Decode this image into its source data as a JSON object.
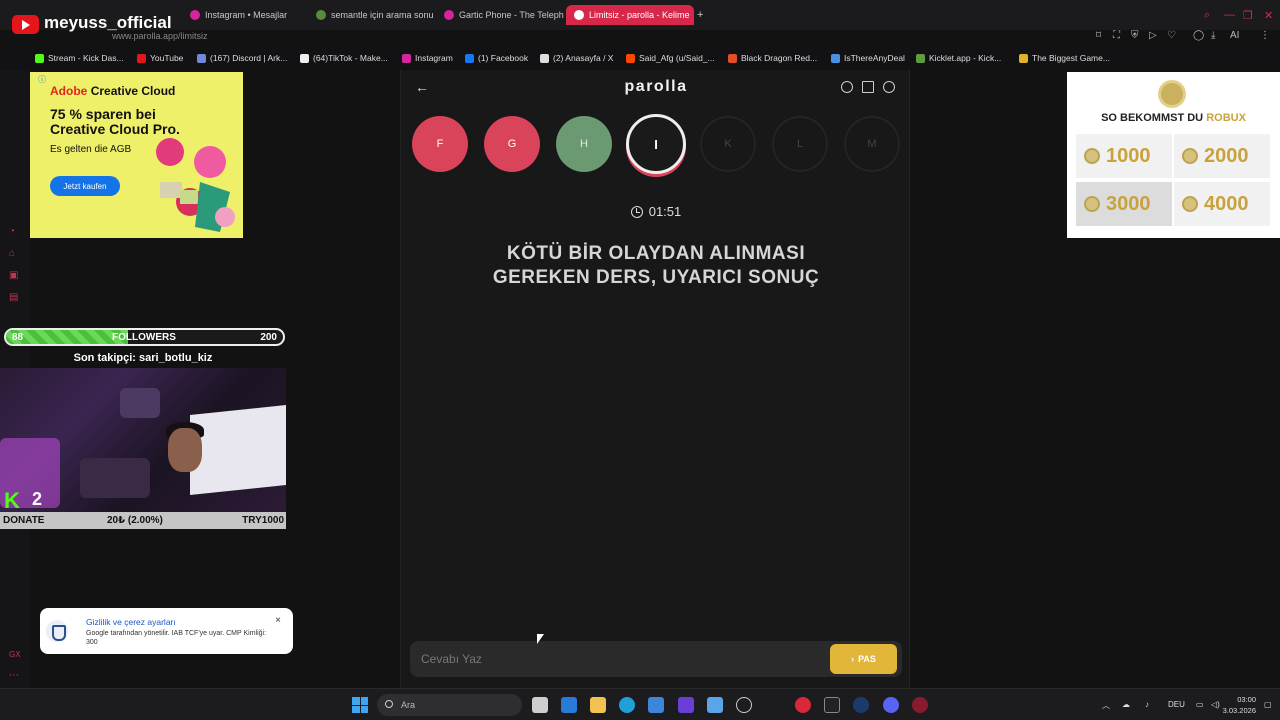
{
  "stream": {
    "channel_name": "meyuss_official",
    "followers_label": "FOLLOWERS",
    "followers_current": "88",
    "followers_goal": "200",
    "followers_progress": 0.44,
    "last_follower": "Son takipçi: sari_botlu_kiz",
    "kick_count": "2",
    "donate_label": "DONATE",
    "donate_amount": "20₺ (2.00%)",
    "donate_goal": "TRY1000"
  },
  "browser": {
    "url": "www.parolla.app/limitsiz",
    "tabs": [
      {
        "label": "Instagram • Mesajlar"
      },
      {
        "label": "semantle için arama sonu"
      },
      {
        "label": "Gartic Phone - The Teleph"
      },
      {
        "label": "Limitsiz - parolla - Kelime",
        "active": true
      }
    ],
    "bookmarks": [
      {
        "label": "Stream - Kick Das...",
        "color": "#53fc18"
      },
      {
        "label": "YouTube",
        "color": "#e4161b"
      },
      {
        "label": "(167) Discord | Ark...",
        "color": "#7289da"
      },
      {
        "label": "(64)TikTok - Make...",
        "color": "#eeeeee"
      },
      {
        "label": "Instagram",
        "color": "#d6249f"
      },
      {
        "label": "(1) Facebook",
        "color": "#1877f2"
      },
      {
        "label": "(2) Anasayfa / X",
        "color": "#dddddd"
      },
      {
        "label": "Said_Afg (u/Said_...",
        "color": "#ff4500"
      },
      {
        "label": "Black Dragon Red...",
        "color": "#e44d26"
      },
      {
        "label": "IsThereAnyDeal",
        "color": "#4a90e2"
      },
      {
        "label": "Kicklet.app - Kick...",
        "color": "#5c9d3e"
      },
      {
        "label": "The Biggest Game...",
        "color": "#e0b030"
      }
    ]
  },
  "ad_left": {
    "brand_prefix": "Adobe",
    "brand_rest": "Creative Cloud",
    "headline": "75 % sparen bei Creative Cloud Pro.",
    "terms": "Es gelten die AGB",
    "cta": "Jetzt kaufen"
  },
  "ad_right": {
    "title_prefix": "SO BEKOMMST DU",
    "title_highlight": "ROBUX",
    "options": [
      "1000",
      "2000",
      "3000",
      "4000"
    ]
  },
  "cookie": {
    "title": "Gizlilik ve çerez ayarları",
    "body": "Google tarafından yönetilir. IAB TCF'ye uyar. CMP Kimliği: 300",
    "close": "×"
  },
  "game": {
    "logo": "parolla",
    "letters": [
      {
        "char": "F",
        "state": "wrong"
      },
      {
        "char": "G",
        "state": "wrong"
      },
      {
        "char": "H",
        "state": "right"
      },
      {
        "char": "I",
        "state": "current"
      },
      {
        "char": "K",
        "state": "pending"
      },
      {
        "char": "L",
        "state": "pending"
      },
      {
        "char": "M",
        "state": "pending"
      }
    ],
    "timer": "01:51",
    "question": "KÖTÜ BİR OLAYDAN ALINMASI GEREKEN DERS, UYARICI SONUÇ",
    "answer_placeholder": "Cevabı Yaz",
    "pass_label": "PAS"
  },
  "taskbar": {
    "search_placeholder": "Ara",
    "language": "DEU",
    "time": "03:00",
    "date": "3.03.2026"
  },
  "colors": {
    "accent": "#d7284a",
    "wrong": "#d9445a",
    "right": "#6b9a72",
    "pass_button": "#e2b638"
  }
}
